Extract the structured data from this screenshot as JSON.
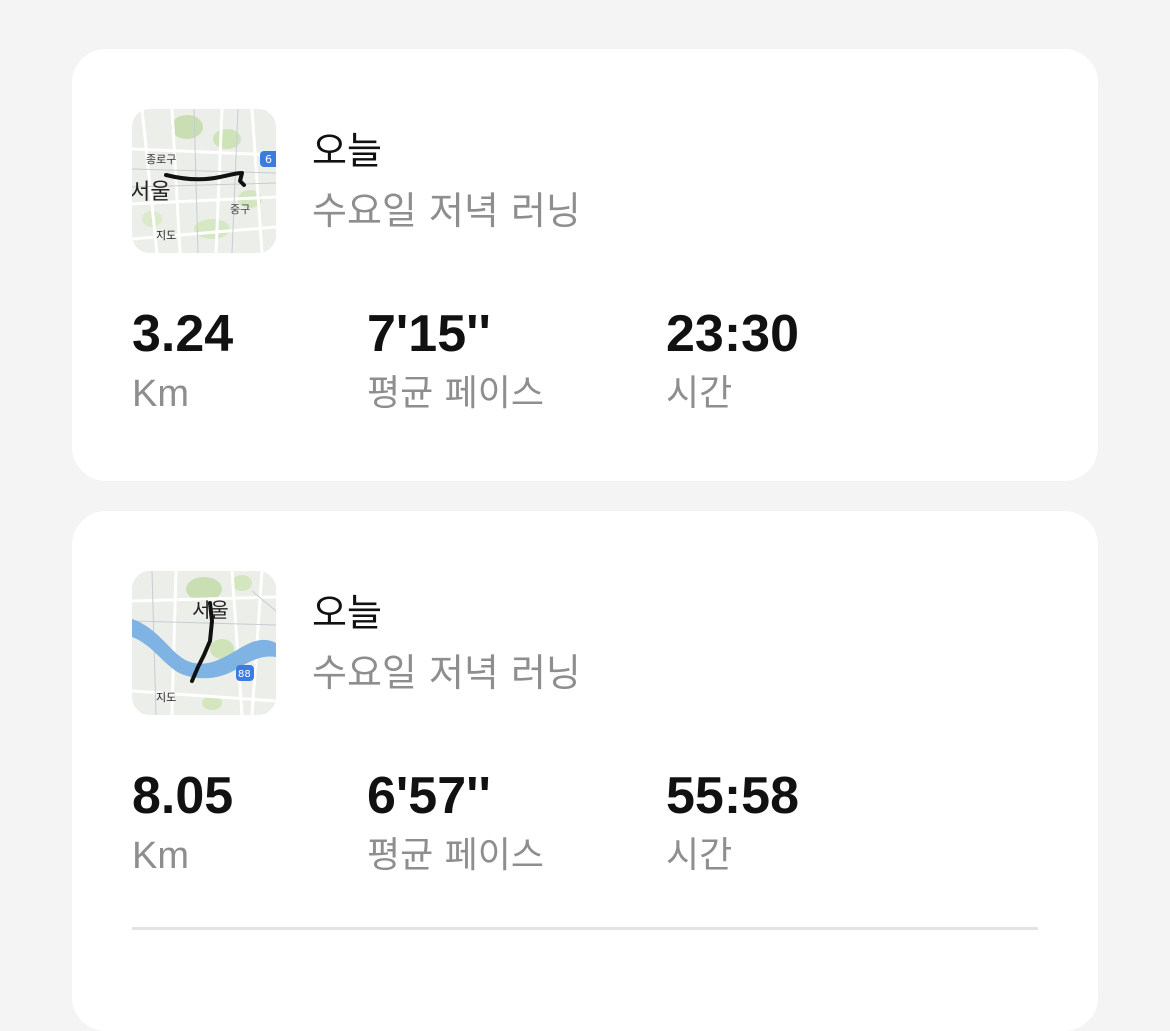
{
  "activities": [
    {
      "map": {
        "labels": [
          "종로구",
          "서울",
          "중구",
          "지도"
        ],
        "route_color": "#111111",
        "badge_number": "6"
      },
      "date": "오늘",
      "title": "수요일 저녁 러닝",
      "stats": {
        "distance_value": "3.24",
        "distance_label": "Km",
        "pace_value": "7'15''",
        "pace_label": "평균 페이스",
        "time_value": "23:30",
        "time_label": "시간"
      }
    },
    {
      "map": {
        "labels": [
          "서울",
          "지도"
        ],
        "route_color": "#111111",
        "river_color": "#7fb3e3",
        "badge_number": "88"
      },
      "date": "오늘",
      "title": "수요일 저녁 러닝",
      "stats": {
        "distance_value": "8.05",
        "distance_label": "Km",
        "pace_value": "6'57''",
        "pace_label": "평균 페이스",
        "time_value": "55:58",
        "time_label": "시간"
      }
    }
  ]
}
